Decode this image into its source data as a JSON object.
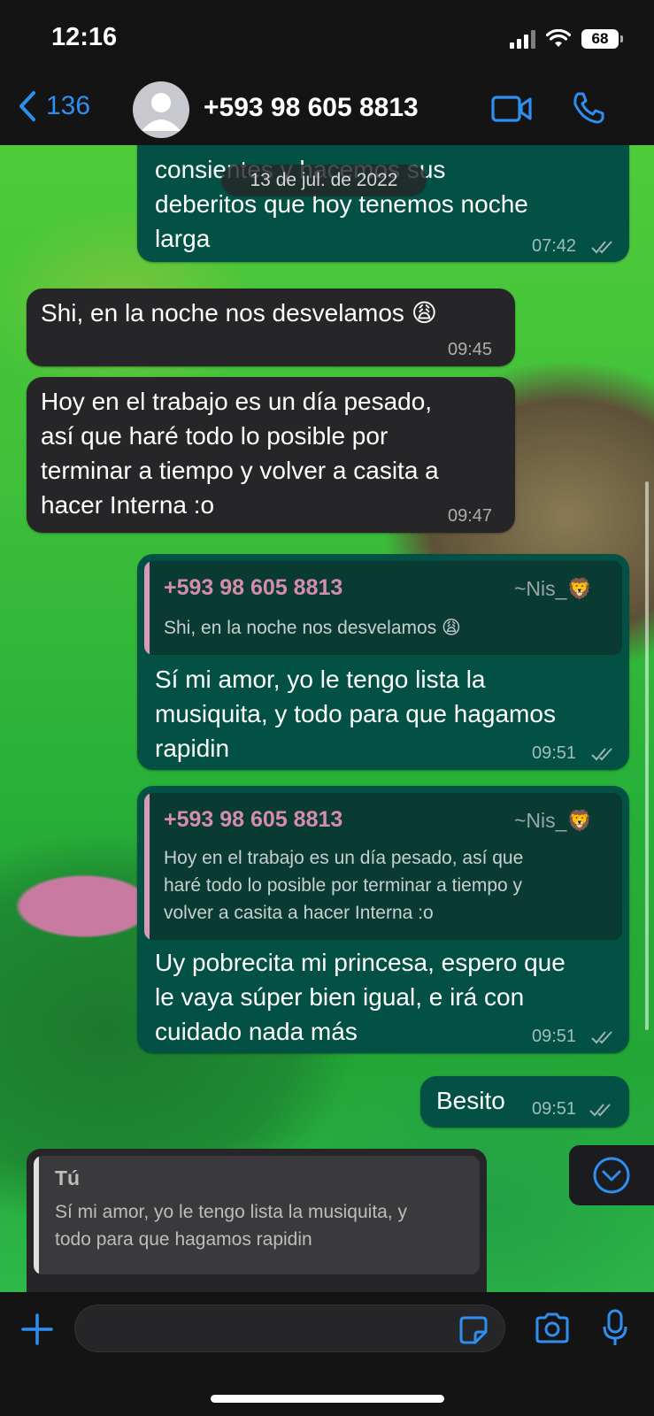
{
  "status_bar": {
    "time": "12:16",
    "battery": "68"
  },
  "header": {
    "back_count": "136",
    "contact": "+593 98 605 8813"
  },
  "chat": {
    "date_badge": "13 de jul. de 2022",
    "messages": [
      {
        "text_top": "consientes y hacemos sus",
        "text_lines": "deberitos que hoy tenemos noche\nlarga",
        "time": "07:42"
      },
      {
        "text": "Shi, en la noche nos desvelamos 😩",
        "time": "09:45"
      },
      {
        "text": "Hoy en el trabajo es un día pesado,\nasí que haré todo lo posible por\nterminar a tiempo y volver a casita a\nhacer Interna :o",
        "time": "09:47"
      },
      {
        "quote_author": "+593 98 605 8813",
        "quote_tag": "~Nis_🦁",
        "quote_text": "Shi, en la noche nos desvelamos 😩",
        "text": "Sí mi amor, yo le tengo lista la\nmusiquita, y todo para que hagamos\nrapidin",
        "time": "09:51"
      },
      {
        "quote_author": "+593 98 605 8813",
        "quote_tag": "~Nis_🦁",
        "quote_text": "Hoy en el trabajo es un día pesado, así que\nharé todo lo posible por terminar a tiempo y\nvolver a casita a hacer Interna :o",
        "text": "Uy pobrecita mi princesa, espero que\nle vaya súper bien igual, e irá con\ncuidado nada más",
        "time": "09:51"
      },
      {
        "text": "Besito",
        "time": "09:51"
      }
    ],
    "reply_preview": {
      "author": "Tú",
      "text": "Sí mi amor, yo le tengo lista la musiquita, y\ntodo para que hagamos rapidin"
    }
  },
  "colors": {
    "accent": "#2f8ff0",
    "incoming_bubble": "#262628",
    "outgoing_bubble": "#025144",
    "quote_author": "#d58da9"
  },
  "icons": [
    "back-chevron-icon",
    "avatar-icon",
    "video-call-icon",
    "phone-icon",
    "plus-icon",
    "sticker-icon",
    "camera-icon",
    "microphone-icon",
    "chevron-down-icon",
    "double-check-icon"
  ]
}
